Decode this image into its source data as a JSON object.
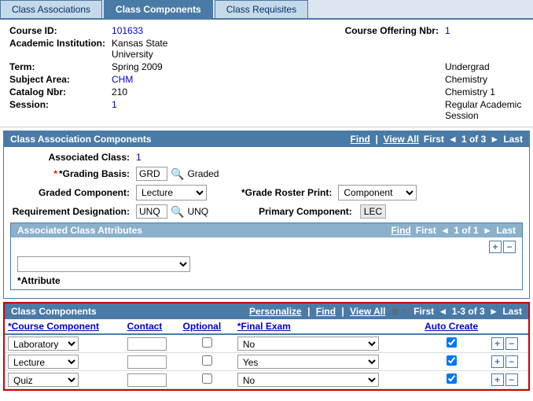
{
  "tabs": [
    {
      "label": "Class Associations",
      "active": false
    },
    {
      "label": "Class Components",
      "active": true
    },
    {
      "label": "Class Requisites",
      "active": false
    }
  ],
  "courseInfo": {
    "courseIdLabel": "Course ID:",
    "courseIdValue": "101633",
    "courseOfferingLabel": "Course Offering Nbr:",
    "courseOfferingValue": "1",
    "institutionLabel": "Academic Institution:",
    "institutionValue": "Kansas State University",
    "termLabel": "Term:",
    "termValue": "Spring 2009",
    "termRightValue": "Undergrad",
    "subjectLabel": "Subject Area:",
    "subjectValue": "CHM",
    "subjectRightLabel": "",
    "subjectRightValue": "Chemistry",
    "catalogLabel": "Catalog Nbr:",
    "catalogValue": "210",
    "catalogRightValue": "Chemistry 1",
    "sessionLabel": "Session:",
    "sessionValue": "1",
    "sessionRightValue": "Regular Academic Session"
  },
  "assocSection": {
    "title": "Class Association Components",
    "findLink": "Find",
    "viewAllLink": "View All",
    "navFirst": "First",
    "navLast": "Last",
    "navCurrent": "1 of 3",
    "assocClassLabel": "Associated Class:",
    "assocClassValue": "1",
    "gradingBasisLabel": "*Grading Basis:",
    "gradingBasisCode": "GRD",
    "gradingBasisText": "Graded",
    "gradedComponentLabel": "Graded Component:",
    "gradedComponentValue": "Lecture",
    "gradeRosterLabel": "*Grade Roster Print:",
    "gradeRosterValue": "Component",
    "reqDesigLabel": "Requirement Designation:",
    "reqDesigCode": "UNQ",
    "reqDesigText": "UNQ",
    "primaryComponentLabel": "Primary Component:",
    "primaryComponentValue": "LEC"
  },
  "attrSection": {
    "title": "Associated Class Attributes",
    "findLink": "Find",
    "navFirst": "First",
    "navLast": "Last",
    "navCurrent": "1 of 1",
    "attributeLabel": "*Attribute",
    "attributeOptions": [
      {
        "label": ""
      }
    ]
  },
  "compSection": {
    "title": "Class Components",
    "personalizeLink": "Personalize",
    "findLink": "Find",
    "viewAllLink": "View All",
    "navCurrent": "1-3 of 3",
    "navFirst": "First",
    "navLast": "Last",
    "colCourseComponent": "*Course Component",
    "colContact": "Contact",
    "colOptional": "Optional",
    "colFinalExam": "*Final Exam",
    "colAutoCreate": "Auto Create",
    "rows": [
      {
        "component": "Laboratory",
        "contact": "",
        "optional": false,
        "finalExam": "No",
        "autoCreate": true
      },
      {
        "component": "Lecture",
        "contact": "",
        "optional": false,
        "finalExam": "Yes",
        "autoCreate": true
      },
      {
        "component": "Quiz",
        "contact": "",
        "optional": false,
        "finalExam": "No",
        "autoCreate": true
      }
    ],
    "finalExamOptions": [
      "No",
      "Yes"
    ],
    "componentOptions": [
      "Laboratory",
      "Lecture",
      "Quiz"
    ]
  }
}
